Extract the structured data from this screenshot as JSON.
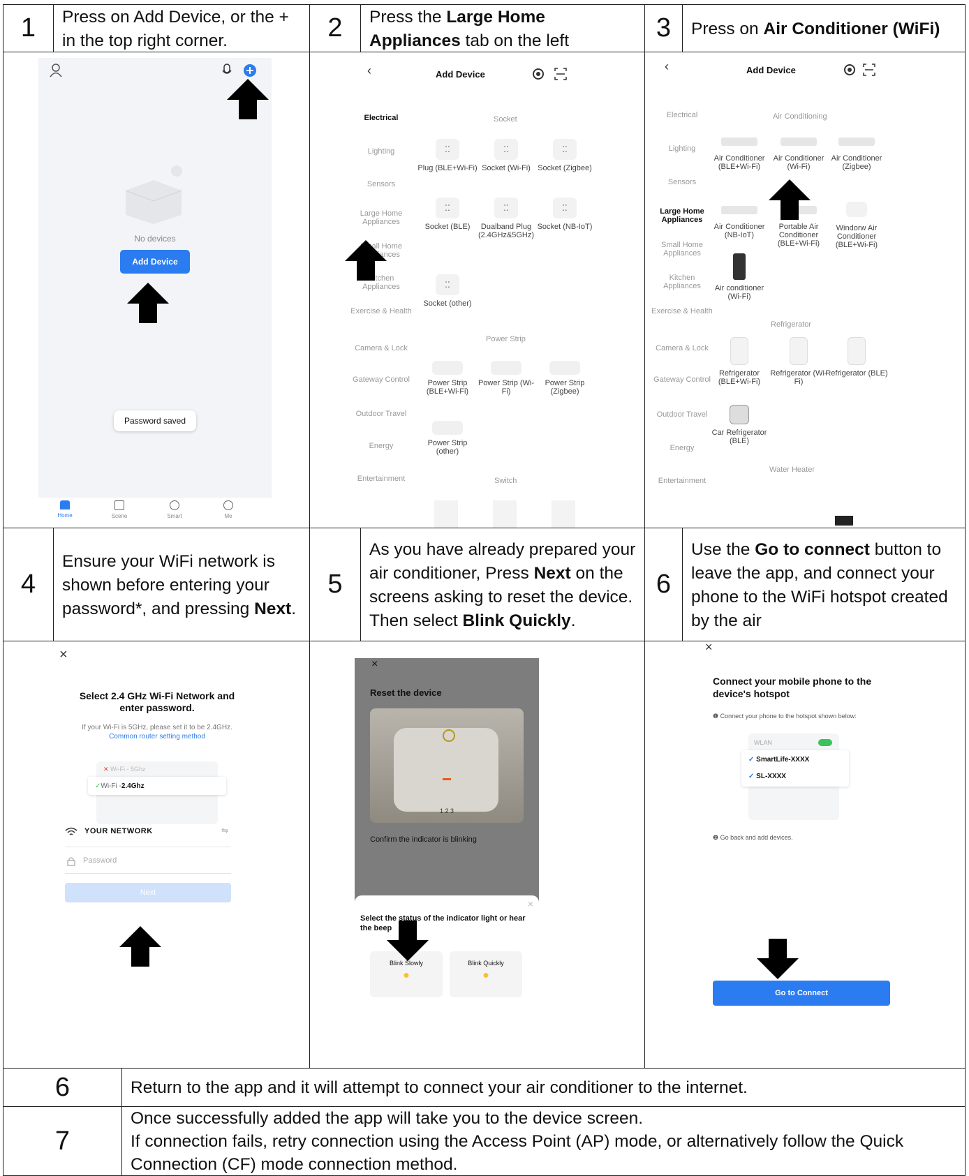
{
  "rows": {
    "step1": {
      "num": "1",
      "text": "Press on Add Device, or the + in the top right corner."
    },
    "step2": {
      "num": "2",
      "pre": "Press the ",
      "bold": "Large Home Appliances",
      "post": " tab on the left"
    },
    "step3": {
      "num": "3",
      "pre": "Press on ",
      "bold": "Air Conditioner (WiFi)",
      "post": ""
    },
    "step4": {
      "num": "4",
      "pre": "Ensure your WiFi network is shown before entering your password*, and pressing ",
      "bold": "Next",
      "post": "."
    },
    "step5": {
      "num": "5",
      "pre": "As you have already prepared your air conditioner, Press ",
      "bold": "Next",
      "mid": " on the screens asking to reset the device. Then select ",
      "bold2": "Blink Quickly",
      "post": "."
    },
    "step6": {
      "num": "6",
      "pre": "Use the ",
      "bold": "Go to connect",
      "post": " button to leave the app, and connect your phone to the WiFi hotspot created by the air"
    },
    "step6b": {
      "num": "6",
      "text": "Return to the app and it will attempt to connect your air conditioner to the internet."
    },
    "step7": {
      "num": "7",
      "line1": "Once successfully added the app will take you to the device screen.",
      "line2": "If connection fails, retry connection using the Access Point (AP) mode, or alternatively follow the Quick Connection (CF) mode connection method."
    }
  },
  "screen1": {
    "empty_text": "No devices",
    "add_button": "Add Device",
    "toast": "Password saved",
    "nav": [
      "Home",
      "Scene",
      "Smart",
      "Me"
    ],
    "icons": [
      "user-icon",
      "mic-icon",
      "plus-circle-icon"
    ]
  },
  "screen2": {
    "title": "Add Device",
    "categories": [
      "Electrical",
      "Lighting",
      "Sensors",
      "Large Home Appliances",
      "Small Home Appliances",
      "Kitchen Appliances",
      "Exercise & Health",
      "Camera & Lock",
      "Gateway Control",
      "Outdoor Travel",
      "Energy",
      "Entertainment"
    ],
    "section_socket": "Socket",
    "socket_devices": [
      "Plug (BLE+Wi-Fi)",
      "Socket (Wi-Fi)",
      "Socket (Zigbee)",
      "Socket (BLE)",
      "Dualband Plug (2.4GHz&5GHz)",
      "Socket (NB-IoT)",
      "Socket (other)"
    ],
    "section_strip": "Power Strip",
    "strip_devices": [
      "Power Strip (BLE+Wi-Fi)",
      "Power Strip (Wi-Fi)",
      "Power Strip (Zigbee)",
      "Power Strip (other)"
    ],
    "section_switch": "Switch"
  },
  "screen3": {
    "title": "Add Device",
    "categories": [
      "Electrical",
      "Lighting",
      "Sensors",
      "Large Home Appliances",
      "Small Home Appliances",
      "Kitchen Appliances",
      "Exercise & Health",
      "Camera & Lock",
      "Gateway Control",
      "Outdoor Travel",
      "Energy",
      "Entertainment"
    ],
    "section_ac": "Air Conditioning",
    "ac_devices": [
      "Air Conditioner (BLE+Wi-Fi)",
      "Air Conditioner (Wi-Fi)",
      "Air Conditioner (Zigbee)",
      "Air Conditioner (NB-IoT)",
      "Portable Air Conditioner (BLE+Wi-Fi)",
      "Windorw Air Conditioner (BLE+Wi-Fi)",
      "Air conditioner (Wi-Fi)"
    ],
    "section_fridge": "Refrigerator",
    "fridge_devices": [
      "Refrigerator (BLE+Wi-Fi)",
      "Refrigerator (Wi-Fi)",
      "Refrigerator (BLE)",
      "Car Refrigerator (BLE)"
    ],
    "section_water": "Water Heater"
  },
  "screen4": {
    "close": "×",
    "heading": "Select 2.4 GHz Wi-Fi Network and enter password.",
    "hint": "If your Wi-Fi is 5GHz, please set it to be 2.4GHz.",
    "link": "Common router setting method",
    "net_bad": "Wi-Fi - 5Ghz",
    "net_good_pre": "Wi-Fi - ",
    "net_good": "2.4Ghz",
    "network": "YOUR NETWORK",
    "password_placeholder": "Password",
    "next": "Next"
  },
  "screen5": {
    "close": "×",
    "heading": "Reset the device",
    "confirm": "Confirm the indicator is blinking",
    "steps": "1 2 3",
    "sheet_title": "Select the status of the indicator light or hear the beep",
    "option1": "Blink Slowly",
    "option2": "Blink Quickly"
  },
  "screen6": {
    "close": "×",
    "heading": "Connect your mobile phone to the device's hotspot",
    "step1": "❶ Connect your phone to the hotspot shown below:",
    "wlan": "WLAN",
    "ssid1": "SmartLife-XXXX",
    "ssid2": "SL-XXXX",
    "step2": "❷ Go back and add devices.",
    "button": "Go to Connect"
  },
  "colors": {
    "accent": "#2b7cf0",
    "border": "#222222",
    "toggle": "#3cc25a"
  }
}
